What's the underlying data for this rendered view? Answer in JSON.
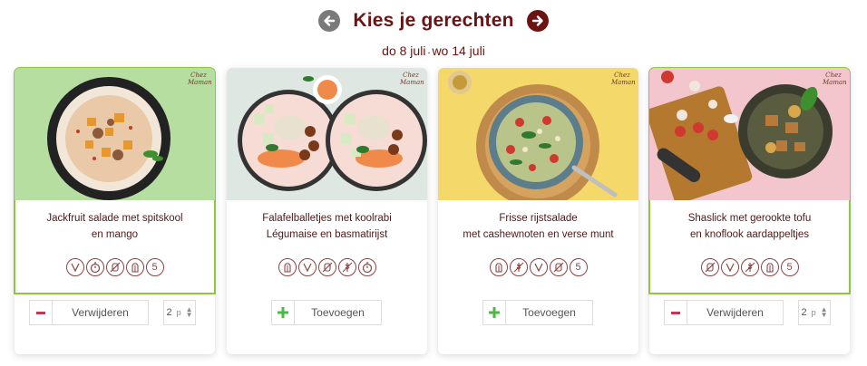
{
  "header": {
    "title": "Kies je gerechten",
    "prev_icon": "arrow-left-icon",
    "next_icon": "arrow-right-icon"
  },
  "week": {
    "start": "do 8 juli",
    "sep": "-",
    "end": "wo 14 juli"
  },
  "colors": {
    "brand": "#6b1212",
    "selected_border": "#8dc63f",
    "remove": "#c43553",
    "add": "#4cb848"
  },
  "logo_text": [
    "Chez",
    "Maman"
  ],
  "cards": [
    {
      "line1": "Jackfruit salade met spitskool",
      "line2": "en mango",
      "selected": true,
      "icons": [
        "vegan-icon",
        "timer-icon",
        "gluten-free-icon",
        "lactose-free-icon"
      ],
      "count": "5",
      "action": "Verwijderen",
      "qty": "2",
      "qty_unit": "p"
    },
    {
      "line1": "Falafelballetjes met koolrabi",
      "line2": "Légumaise en basmatirijst",
      "selected": false,
      "icons": [
        "lactose-free-icon",
        "vegan-icon",
        "gluten-free-icon",
        "grain-free-icon",
        "timer-icon"
      ],
      "count": "",
      "action": "Toevoegen"
    },
    {
      "line1": "Frisse rijstsalade",
      "line2": "met cashewnoten en verse munt",
      "selected": false,
      "icons": [
        "lactose-free-icon",
        "grain-free-icon",
        "vegan-icon",
        "gluten-free-icon"
      ],
      "count": "5",
      "action": "Toevoegen"
    },
    {
      "line1": "Shaslick met gerookte tofu",
      "line2": "en knoflook aardappeltjes",
      "selected": true,
      "icons": [
        "gluten-free-icon",
        "vegan-icon",
        "grain-free-icon",
        "lactose-free-icon"
      ],
      "count": "5",
      "action": "Verwijderen",
      "qty": "2",
      "qty_unit": "p"
    }
  ]
}
